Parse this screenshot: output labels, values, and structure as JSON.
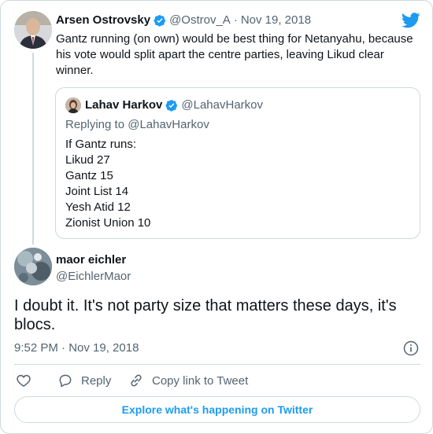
{
  "parent_tweet": {
    "author_name": "Arsen Ostrovsky",
    "handle": "@Ostrov_A",
    "separator": "·",
    "date": "Nov 19, 2018",
    "text": "Gantz running (on own) would be best thing for Netanyahu, because his vote would split apart the centre parties, leaving Likud clear winner."
  },
  "quoted_tweet": {
    "author_name": "Lahav Harkov",
    "handle": "@LahavHarkov",
    "replying_to": "Replying to @LahavHarkov",
    "lines": [
      "If Gantz runs:",
      "Likud 27",
      "Gantz 15",
      "Joint List 14",
      "Yesh Atid 12",
      "Zionist Union 10"
    ]
  },
  "reply_tweet": {
    "author_name": "maor eichler",
    "handle": "@EichlerMaor",
    "text": "I doubt it. It's not party size that matters these days, it's blocs.",
    "timestamp": "9:52 PM · Nov 19, 2018"
  },
  "actions": {
    "reply_label": "Reply",
    "copy_link_label": "Copy link to Tweet"
  },
  "explore_label": "Explore what's happening on Twitter",
  "colors": {
    "twitter_blue": "#1d9bf0",
    "verified_blue": "#1d9bf0",
    "muted_text": "#536471",
    "border": "#cfd9de"
  },
  "icons": [
    "twitter-logo-icon",
    "verified-badge-icon",
    "info-icon",
    "heart-icon",
    "reply-icon",
    "link-icon"
  ]
}
